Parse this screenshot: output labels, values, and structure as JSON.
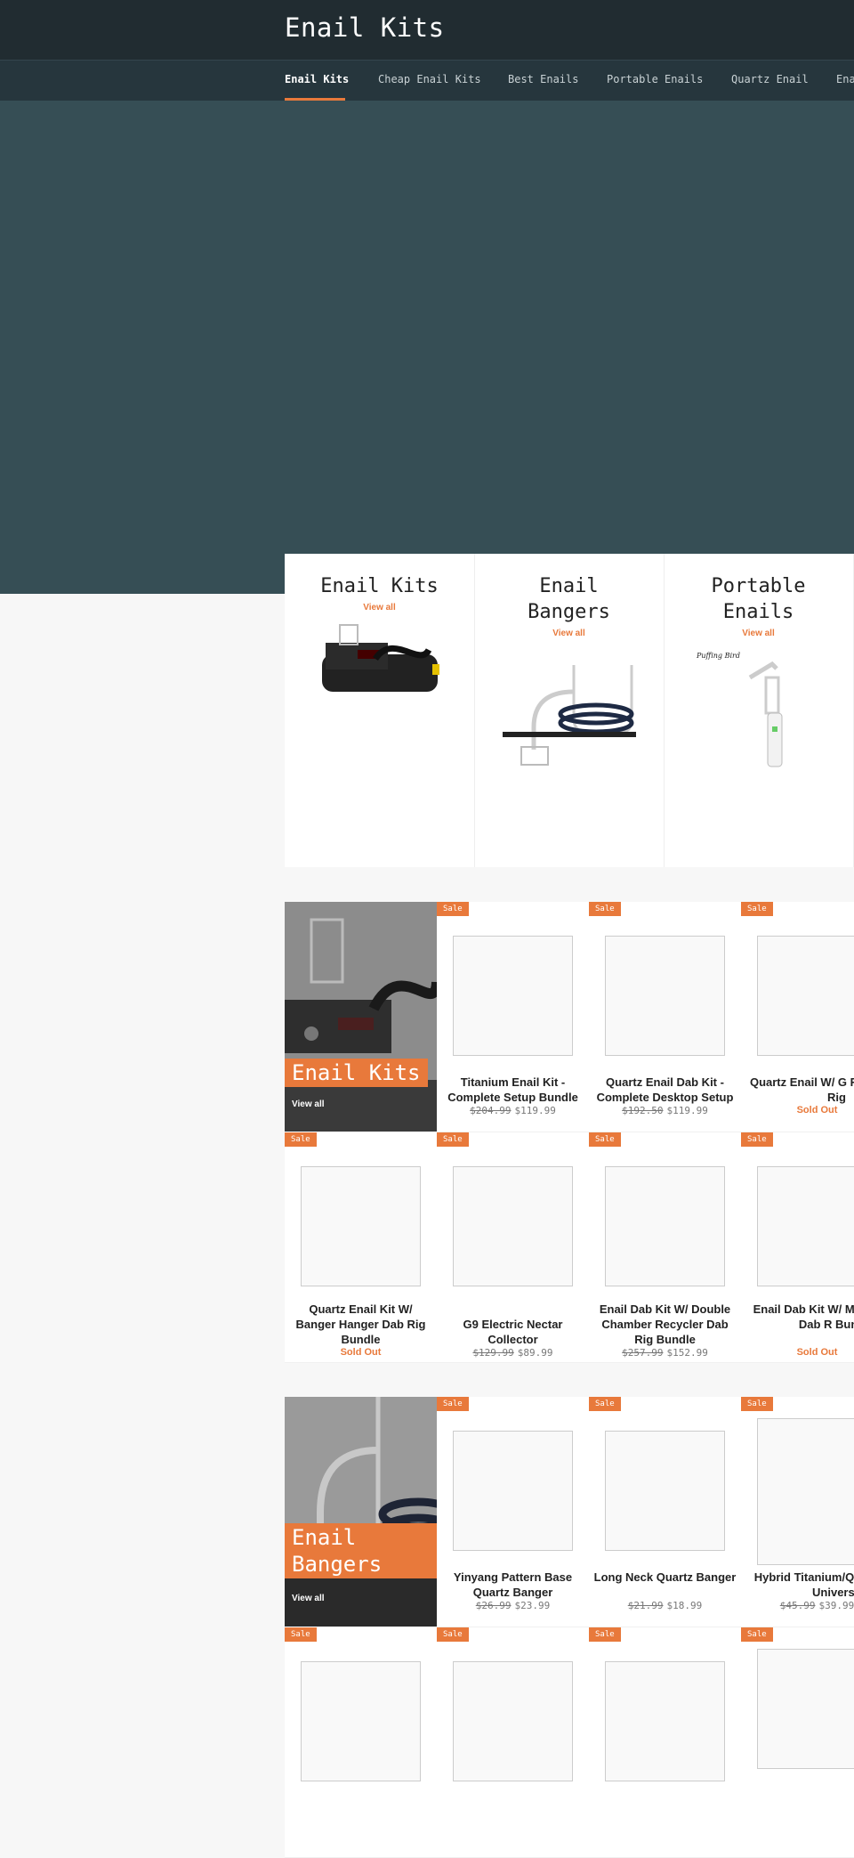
{
  "header": {
    "title": "Enail Kits"
  },
  "nav": [
    {
      "label": "Enail Kits",
      "active": true
    },
    {
      "label": "Cheap Enail Kits"
    },
    {
      "label": "Best Enails"
    },
    {
      "label": "Portable Enails"
    },
    {
      "label": "Quartz Enail"
    },
    {
      "label": "Ena"
    }
  ],
  "collections": [
    {
      "title": "Enail Kits",
      "link": "View all"
    },
    {
      "title": "Enail Bangers",
      "link": "View all"
    },
    {
      "title": "Portable Enails",
      "link": "View all"
    }
  ],
  "section1": {
    "feature": {
      "title": "Enail Kits",
      "link": "View all"
    },
    "products": [
      {
        "badge": "Sale",
        "name": "Titanium Enail Kit - Complete Setup Bundle",
        "old": "$204.99",
        "new": "$119.99"
      },
      {
        "badge": "Sale",
        "name": "Quartz Enail Dab Kit - Complete Desktop Setup",
        "old": "$192.50",
        "new": "$119.99"
      },
      {
        "badge": "Sale",
        "name": "Quartz Enail W/ G Recycler Dab Rig",
        "sold": "Sold Out"
      },
      {
        "badge": "Sale",
        "name": "Quartz Enail Kit W/ Banger Hanger Dab Rig Bundle",
        "sold": "Sold Out"
      },
      {
        "badge": "Sale",
        "name": "G9 Electric Nectar Collector",
        "old": "$129.99",
        "new": "$89.99"
      },
      {
        "badge": "Sale",
        "name": "Enail Dab Kit W/ Double Chamber Recycler Dab Rig Bundle",
        "old": "$257.99",
        "new": "$152.99"
      },
      {
        "badge": "Sale",
        "name": "Enail Dab Kit W/ M Matrix Perc Dab R Bundle",
        "sold": "Sold Out"
      }
    ]
  },
  "section2": {
    "feature": {
      "title": "Enail Bangers",
      "link": "View all"
    },
    "products": [
      {
        "badge": "Sale",
        "name": "Yinyang Pattern Base Quartz Banger",
        "old": "$26.99",
        "new": "$23.99"
      },
      {
        "badge": "Sale",
        "name": "Long Neck Quartz Banger",
        "old": "$21.99",
        "new": "$18.99"
      },
      {
        "badge": "Sale",
        "name": "Hybrid Titanium/Qu Domeless Universa",
        "old": "$45.99",
        "new": "$39.99"
      },
      {
        "badge": "Sale"
      },
      {
        "badge": "Sale"
      },
      {
        "badge": "Sale"
      },
      {
        "badge": "Sale"
      }
    ]
  },
  "colors": {
    "accent": "#e8793b",
    "header": "#212c31",
    "nav": "#26363d",
    "hero": "#364e55"
  }
}
